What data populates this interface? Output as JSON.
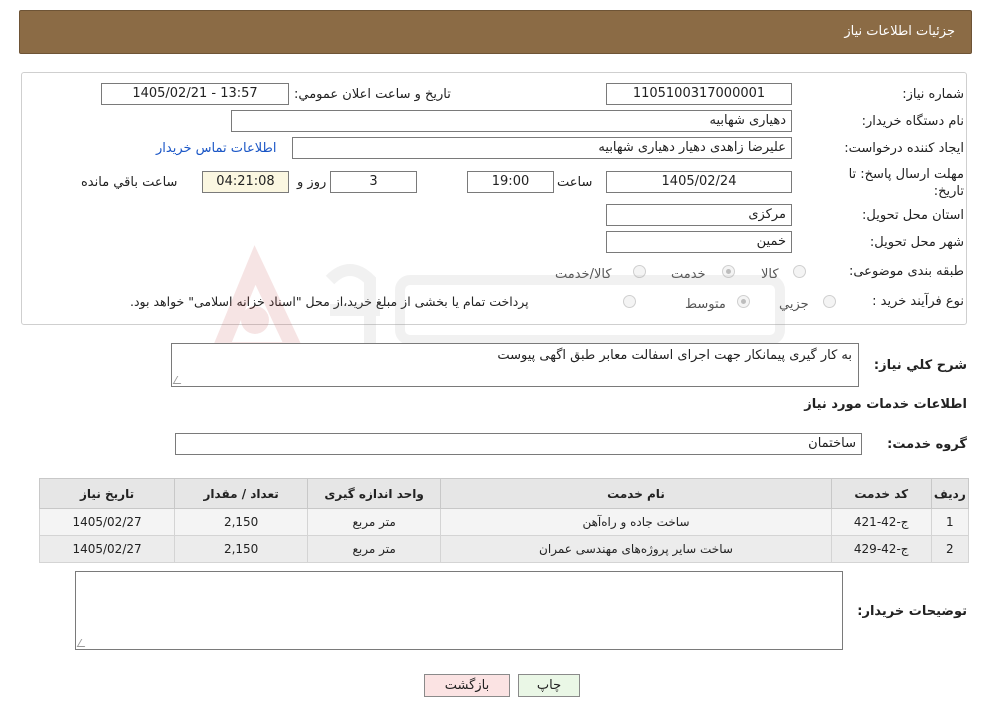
{
  "header": {
    "title": "جزئیات اطلاعات نیاز"
  },
  "fields": {
    "need_number_label": "شماره نیاز:",
    "need_number": "1105100317000001",
    "announce_label": "تاریخ و ساعت اعلان عمومي:",
    "announce_value": "1405/02/21 - 13:57",
    "buyer_org_label": "نام دستگاه خريدار:",
    "buyer_org": "دهیاری شهابیه",
    "creator_label": "ايجاد کننده درخواست:",
    "creator": "علیرضا زاهدی دهیار دهیاری شهابیه",
    "contact_link": "اطلاعات تماس خريدار",
    "deadline_label": "مهلت ارسال پاسخ: تا تاریخ:",
    "deadline_date": "1405/02/24",
    "time_label": "ساعت",
    "deadline_time": "19:00",
    "days_value": "3",
    "days_label": "روز و",
    "remaining_time": "04:21:08",
    "remaining_label": "ساعت باقي مانده",
    "province_label": "استان محل تحویل:",
    "province": "مرکزی",
    "city_label": "شهر محل تحویل:",
    "city": "خمین",
    "category_label": "طبقه بندی موضوعی:",
    "category_options": [
      "کالا",
      "خدمت",
      "کالا/خدمت"
    ],
    "purchase_type_label": "نوع فرآیند خرید :",
    "purchase_options": [
      "جزيي",
      "متوسط"
    ],
    "purchase_note": "پرداخت تمام یا بخشی از مبلغ خرید،از محل \"اسناد خزانه اسلامی\" خواهد بود."
  },
  "description": {
    "label": "شرح کلي نياز:",
    "text": "به کار گیری پیمانکار جهت اجرای اسفالت معابر طبق اگهی پیوست"
  },
  "services": {
    "section_title": "اطلاعات خدمات مورد نياز",
    "group_label": "گروه خدمت:",
    "group_value": "ساختمان",
    "columns": [
      "رديف",
      "کد خدمت",
      "نام خدمت",
      "واحد اندازه گيری",
      "تعداد / مقدار",
      "تاريخ نياز"
    ],
    "rows": [
      [
        "1",
        "ج-42-421",
        "ساخت جاده و راه‌آهن",
        "متر مربع",
        "2,150",
        "1405/02/27"
      ],
      [
        "2",
        "ج-42-429",
        "ساخت سایر پروژه‌های مهندسی عمران",
        "متر مربع",
        "2,150",
        "1405/02/27"
      ]
    ]
  },
  "notes": {
    "label": "توضيحات خريدار:"
  },
  "buttons": {
    "print": "چاپ",
    "back": "بازگشت"
  },
  "colors": {
    "header_bg": "#8b6b45",
    "link": "#1a56c6",
    "print_bg": "#eaf7e6",
    "back_bg": "#fbe3e3"
  }
}
